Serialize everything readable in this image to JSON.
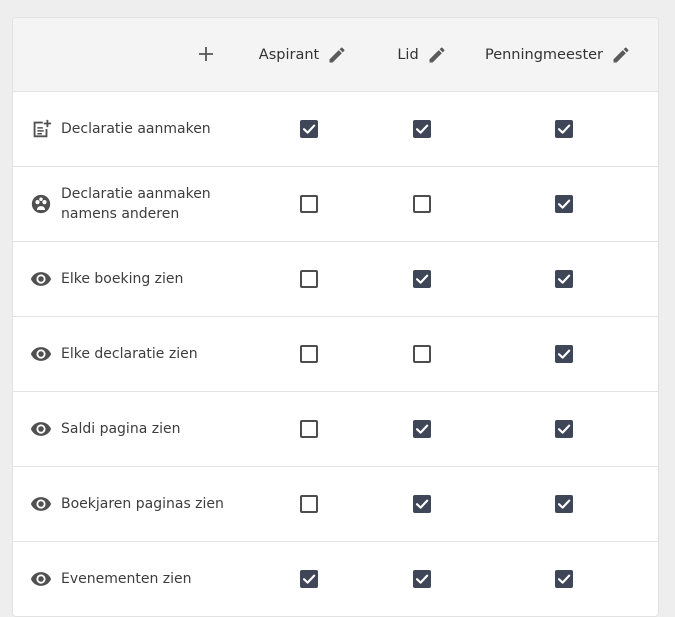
{
  "header": {
    "add_icon": "plus-icon",
    "roles": [
      {
        "label": "Aspirant",
        "edit_icon": "pencil-icon"
      },
      {
        "label": "Lid",
        "edit_icon": "pencil-icon"
      },
      {
        "label": "Penningmeester",
        "edit_icon": "pencil-icon"
      }
    ]
  },
  "colors": {
    "checked": "#3e4657",
    "unchecked_border": "#4d4d4d",
    "header_bg": "#f4f4f4"
  },
  "permissions": [
    {
      "label": "Declaratie aanmaken",
      "icon": "note-add-icon",
      "checked": [
        true,
        true,
        true
      ]
    },
    {
      "label": "Declaratie aanmaken namens anderen",
      "icon": "group-icon",
      "checked": [
        false,
        false,
        true
      ]
    },
    {
      "label": "Elke boeking zien",
      "icon": "eye-icon",
      "checked": [
        false,
        true,
        true
      ]
    },
    {
      "label": "Elke declaratie zien",
      "icon": "eye-icon",
      "checked": [
        false,
        false,
        true
      ]
    },
    {
      "label": "Saldi pagina zien",
      "icon": "eye-icon",
      "checked": [
        false,
        true,
        true
      ]
    },
    {
      "label": "Boekjaren paginas zien",
      "icon": "eye-icon",
      "checked": [
        false,
        true,
        true
      ]
    },
    {
      "label": "Evenementen zien",
      "icon": "eye-icon",
      "checked": [
        true,
        true,
        true
      ]
    }
  ]
}
